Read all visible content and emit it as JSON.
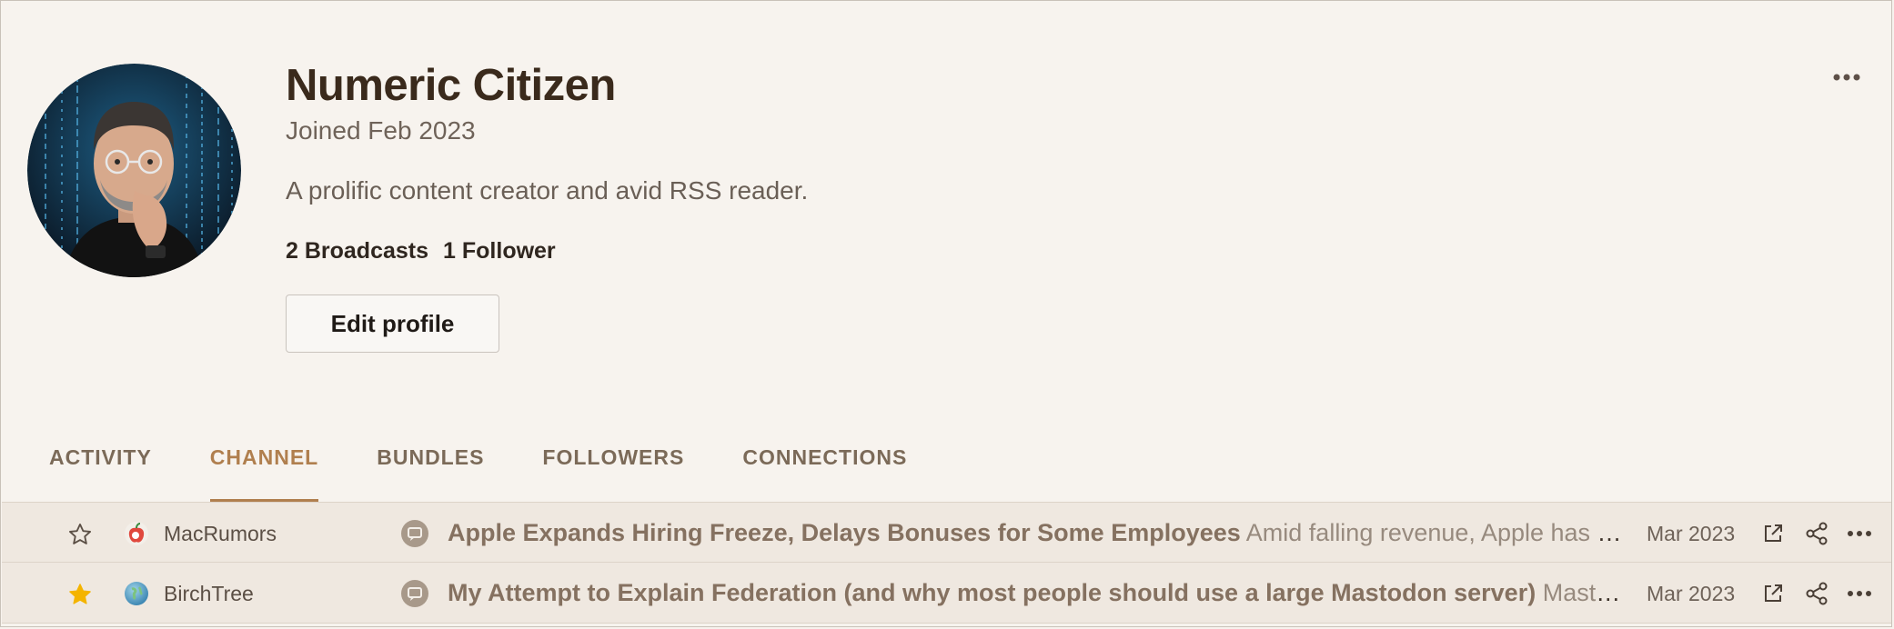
{
  "profile": {
    "name": "Numeric Citizen",
    "joined": "Joined Feb 2023",
    "bio": "A prolific content creator and avid RSS reader.",
    "broadcasts": "2 Broadcasts",
    "followers": "1 Follower",
    "edit_label": "Edit profile",
    "avatar": "user-portrait"
  },
  "tabs": [
    {
      "label": "ACTIVITY",
      "active": false
    },
    {
      "label": "CHANNEL",
      "active": true
    },
    {
      "label": "BUNDLES",
      "active": false
    },
    {
      "label": "FOLLOWERS",
      "active": false
    },
    {
      "label": "CONNECTIONS",
      "active": false
    }
  ],
  "items": [
    {
      "starred": false,
      "source": "MacRumors",
      "source_icon": "apple-feed-icon",
      "headline": "Apple Expands Hiring Freeze, Delays Bonuses for Some Employees",
      "excerpt": "Amid falling revenue, Apple has de...",
      "date": "Mar 2023"
    },
    {
      "starred": true,
      "source": "BirchTree",
      "source_icon": "globe-feed-icon",
      "headline": "My Attempt to Explain Federation (and why most people should use a large Mastodon server)",
      "excerpt": "Masto.h...",
      "date": "Mar 2023"
    }
  ],
  "colors": {
    "background": "#f7f3ee",
    "accent": "#b07f4e",
    "row_background": "#efe8e0",
    "star_active": "#f4b400"
  }
}
